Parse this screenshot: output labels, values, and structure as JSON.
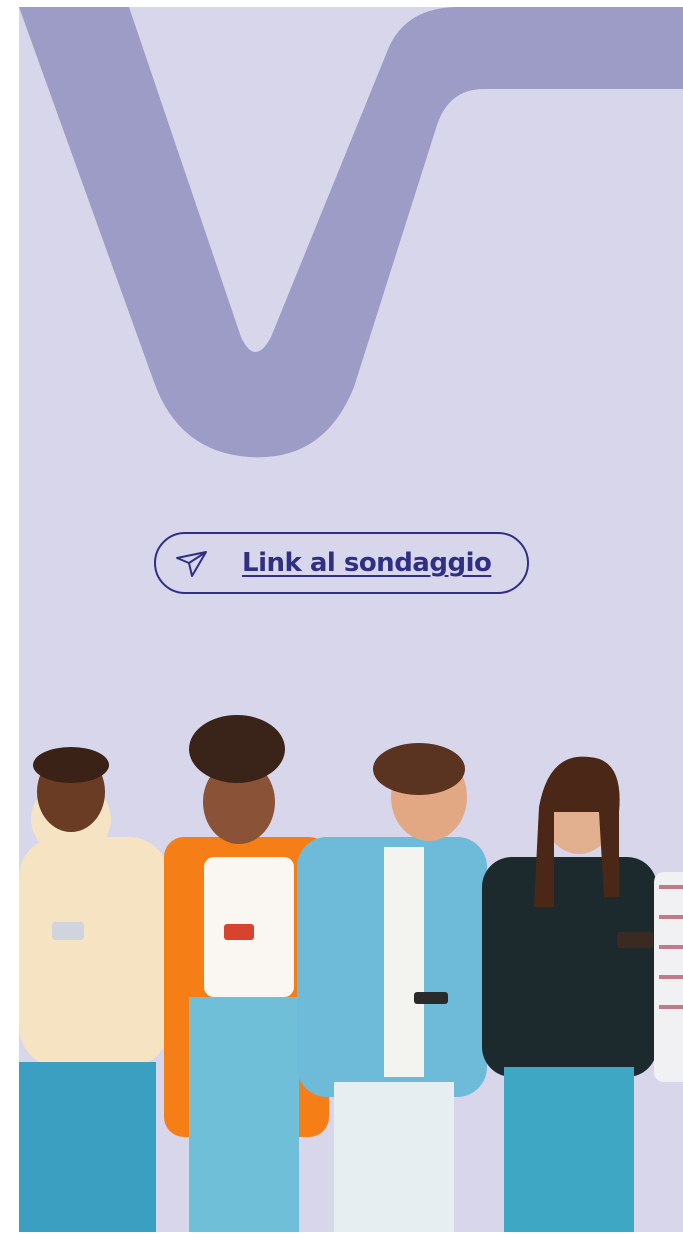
{
  "survey_link": {
    "label": "Link al sondaggio",
    "icon": "send-icon"
  },
  "hero_image": {
    "subject": "people-group"
  },
  "colors": {
    "background": "#d8d6ea",
    "brand_shape": "#9d9cc7",
    "link_text": "#2f2f86"
  }
}
